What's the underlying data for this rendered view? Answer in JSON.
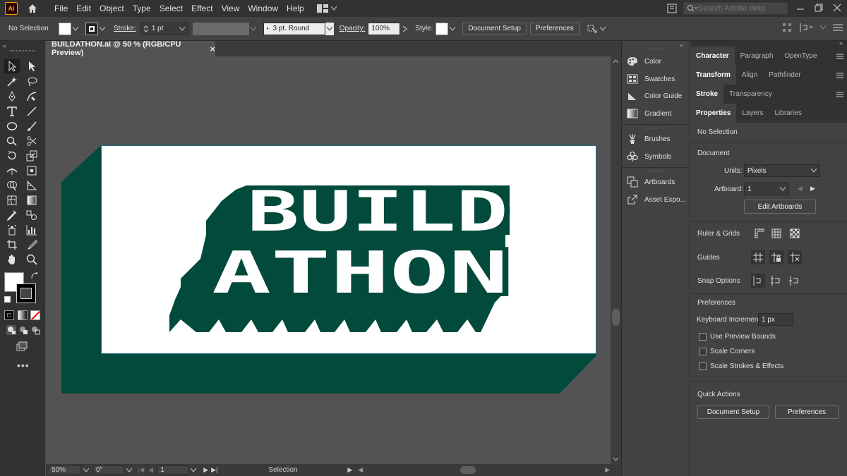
{
  "app": {
    "logo_text": "Ai"
  },
  "menu": [
    "File",
    "Edit",
    "Object",
    "Type",
    "Select",
    "Effect",
    "View",
    "Window",
    "Help"
  ],
  "search": {
    "placeholder": "Search Adobe Help"
  },
  "control_bar": {
    "selection_label": "No Selection",
    "stroke_label": "Stroke:",
    "stroke_value": "1 pt",
    "brush_value": "3 pt. Round",
    "opacity_label": "Opacity:",
    "opacity_value": "100%",
    "style_label": "Style:",
    "document_setup": "Document Setup",
    "preferences": "Preferences"
  },
  "document": {
    "tab_title": "BUILDATHON.ai @ 50 % (RGB/CPU Preview)",
    "close_glyph": "×",
    "artwork_line1": "BUILD",
    "artwork_line2": "ATHON",
    "colors": {
      "artboard": "#ffffff",
      "brand_green": "#024a3c",
      "pasteboard": "#535353"
    }
  },
  "status_bar": {
    "zoom": "50%",
    "rotation": "0°",
    "artboard_num": "1",
    "tool_name": "Selection"
  },
  "mid_panel": [
    {
      "label": "Color",
      "icon": "color-palette-icon"
    },
    {
      "label": "Swatches",
      "icon": "swatches-icon"
    },
    {
      "label": "Color Guide",
      "icon": "color-guide-icon"
    },
    {
      "label": "Gradient",
      "icon": "gradient-icon"
    },
    {
      "label": "Brushes",
      "icon": "brushes-icon"
    },
    {
      "label": "Symbols",
      "icon": "symbols-icon"
    },
    {
      "label": "Artboards",
      "icon": "artboards-icon"
    },
    {
      "label": "Asset Expo...",
      "icon": "asset-export-icon"
    }
  ],
  "right_panel": {
    "tabs_row1": [
      "Character",
      "Paragraph",
      "OpenType"
    ],
    "tabs_row2": [
      "Transform",
      "Align",
      "Pathfinder"
    ],
    "tabs_row3": [
      "Stroke",
      "Transparency"
    ],
    "tabs_row4": [
      "Properties",
      "Layers",
      "Libraries"
    ],
    "no_selection": "No Selection",
    "document_heading": "Document",
    "units_label": "Units:",
    "units_value": "Pixels",
    "artboard_label": "Artboard:",
    "artboard_value": "1",
    "edit_artboards": "Edit Artboards",
    "rulers_grids": "Ruler & Grids",
    "guides": "Guides",
    "snap_options": "Snap Options",
    "preferences_heading": "Preferences",
    "keyboard_increment_label": "Keyboard Increment:",
    "keyboard_increment_value": "1 px",
    "use_preview_bounds": "Use Preview Bounds",
    "scale_corners": "Scale Corners",
    "scale_strokes": "Scale Strokes & Effects",
    "quick_actions": "Quick Actions",
    "doc_setup_btn": "Document Setup",
    "preferences_btn": "Preferences"
  }
}
